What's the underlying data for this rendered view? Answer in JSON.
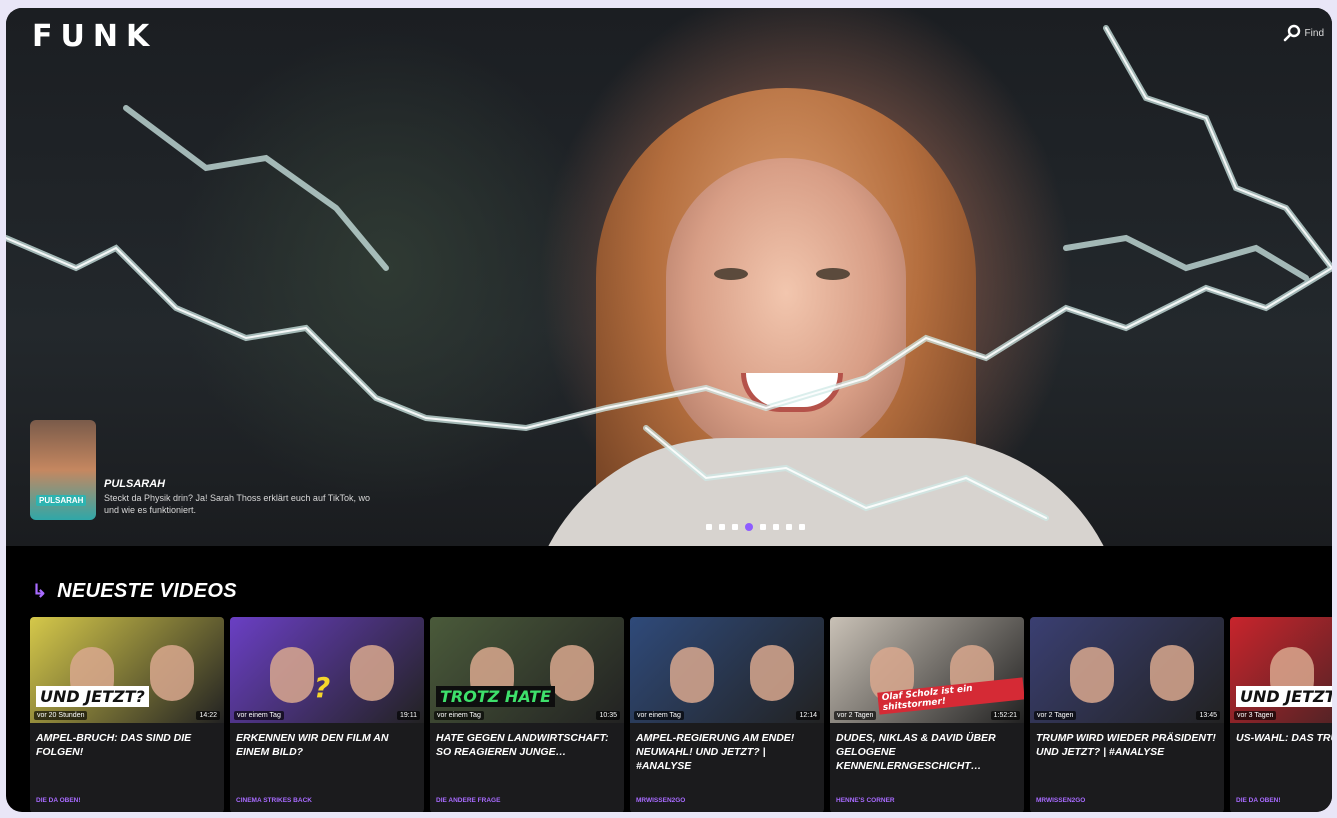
{
  "app": {
    "logo_letters": [
      "F",
      "U",
      "N",
      "K"
    ],
    "search_label": "Find"
  },
  "hero": {
    "promo": {
      "title": "PULSARAH",
      "description": "Steckt da Physik drin? Ja! Sarah Thoss erklärt euch auf TikTok, wo und wie es funktioniert."
    },
    "slides_total": 8,
    "active_slide": 4
  },
  "section": {
    "title": "NEUESTE VIDEOS",
    "arrow_icon": "arrow-icon"
  },
  "videos": [
    {
      "thumb_text": "UND JETZT?",
      "date": "vor 20 Stunden",
      "duration": "14:22",
      "title": "AMPEL-BRUCH: DAS SIND DIE FOLGEN!",
      "channel": "DIE DA OBEN!",
      "bg": "#d5c84a"
    },
    {
      "thumb_text": "?",
      "date": "vor einem Tag",
      "duration": "19:11",
      "title": "ERKENNEN WIR DEN FILM AN EINEM BILD?",
      "channel": "CINEMA STRIKES BACK",
      "bg": "#6a3fc4"
    },
    {
      "thumb_text": "TROTZ HATE",
      "date": "vor einem Tag",
      "duration": "10:35",
      "title": "HATE GEGEN LANDWIRTSCHAFT: SO REAGIEREN JUNGE…",
      "channel": "DIE ANDERE FRAGE",
      "bg": "#4a5a3a"
    },
    {
      "thumb_text": "",
      "date": "vor einem Tag",
      "duration": "12:14",
      "title": "AMPEL-REGIERUNG AM ENDE! NEUWAHL! UND JETZT? | #ANALYSE",
      "channel": "MRWISSEN2GO",
      "bg": "#2f4a7a"
    },
    {
      "thumb_text": "Olaf Scholz ist ein shitstormer!",
      "date": "vor 2 Tagen",
      "duration": "1:52:21",
      "title": "DUDES, NIKLAS & DAVID ÜBER GELOGENE KENNENLERNGESCHICHT…",
      "channel": "HENNE'S CORNER",
      "bg": "#c9c1b6"
    },
    {
      "thumb_text": "",
      "date": "vor 2 Tagen",
      "duration": "13:45",
      "title": "TRUMP WIRD WIEDER PRÄSIDENT! UND JETZT? | #ANALYSE",
      "channel": "MRWISSEN2GO",
      "bg": "#3a3f72"
    },
    {
      "thumb_text": "UND JETZT?",
      "date": "vor 3 Tagen",
      "duration": "",
      "title": "US-WAHL: DAS TRUMPS SIEG I…",
      "channel": "DIE DA OBEN!",
      "bg": "#c8242c"
    }
  ]
}
